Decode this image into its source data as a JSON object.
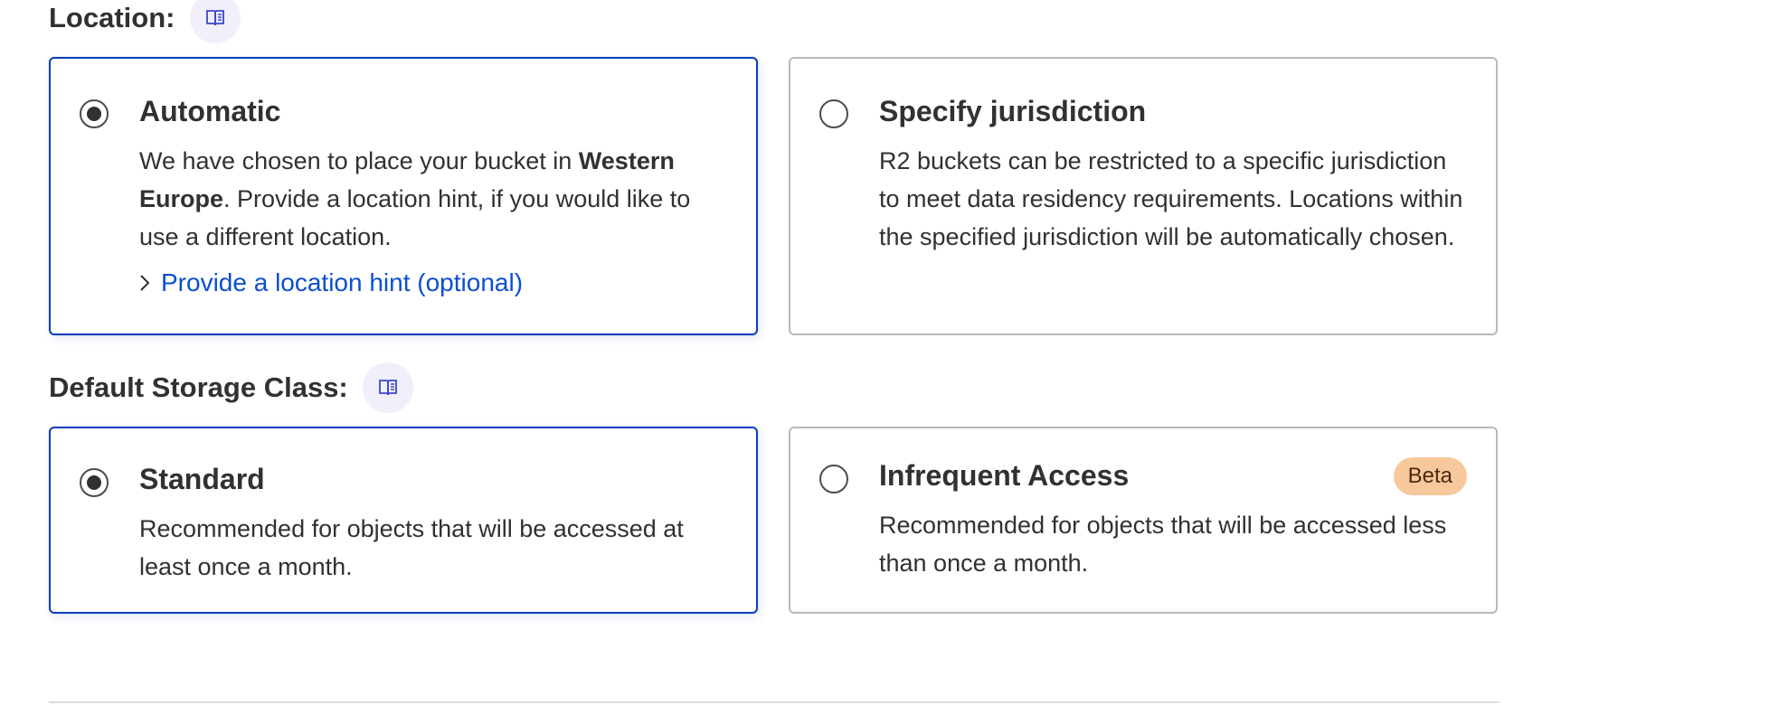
{
  "location": {
    "label": "Location:",
    "options": [
      {
        "title": "Automatic",
        "desc_prefix": "We have chosen to place your bucket in ",
        "desc_bold": "Western Europe",
        "desc_suffix": ". Provide a location hint, if you would like to use a different location.",
        "link": "Provide a location hint (optional)",
        "selected": true
      },
      {
        "title": "Specify jurisdiction",
        "desc": "R2 buckets can be restricted to a specific jurisdiction to meet data residency requirements. Locations within the specified jurisdiction will be automatically chosen.",
        "selected": false
      }
    ]
  },
  "storage_class": {
    "label": "Default Storage Class:",
    "options": [
      {
        "title": "Standard",
        "desc": "Recommended for objects that will be accessed at least once a month.",
        "selected": true
      },
      {
        "title": "Infrequent Access",
        "badge": "Beta",
        "desc": "Recommended for objects that will be accessed less than once a month.",
        "selected": false
      }
    ]
  },
  "colors": {
    "selected_border": "#0a3fb8",
    "link": "#0b4fd0",
    "badge_bg": "#f6c89c",
    "doc_button_bg": "#f1effa"
  },
  "icons": {
    "doc_button": "book-icon",
    "link_chevron": "chevron-right-icon"
  }
}
